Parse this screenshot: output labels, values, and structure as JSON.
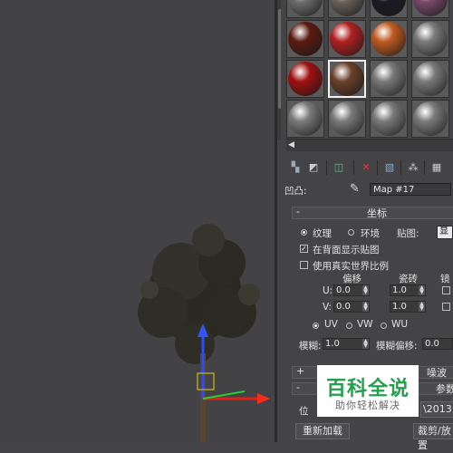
{
  "colors": {
    "viewport_bg": "#434345",
    "panel_bg": "#444446",
    "watermark_green": "#21a14b"
  },
  "slots": [
    {
      "name": "slot-1-1",
      "color": "#6e6e6e"
    },
    {
      "name": "slot-1-2",
      "color": "#6a625c"
    },
    {
      "name": "slot-1-3",
      "color": "#1a1a22"
    },
    {
      "name": "slot-1-4",
      "color": "#7a4a6a"
    },
    {
      "name": "slot-2-1",
      "color": "#5a1a10"
    },
    {
      "name": "slot-2-2",
      "color": "#b02020"
    },
    {
      "name": "slot-2-3",
      "color": "#c05a20"
    },
    {
      "name": "slot-2-4",
      "color": "#7a7a7a"
    },
    {
      "name": "slot-3-1",
      "color": "#a01010"
    },
    {
      "name": "slot-3-2",
      "color": "#6a4028"
    },
    {
      "name": "slot-3-3",
      "color": "#7a7a7a"
    },
    {
      "name": "slot-3-4",
      "color": "#7a7a7a"
    },
    {
      "name": "slot-4-1",
      "color": "#7a7a7a"
    },
    {
      "name": "slot-4-2",
      "color": "#7a7a7a"
    },
    {
      "name": "slot-4-3",
      "color": "#7a7a7a"
    },
    {
      "name": "slot-4-4",
      "color": "#7a7a7a"
    }
  ],
  "toolbar": {
    "icons": [
      {
        "name": "get-material-icon",
        "glyph": "▚",
        "color": "#9ab"
      },
      {
        "name": "put-to-scene-icon",
        "glyph": "◩",
        "color": "#ccc"
      },
      {
        "name": "assign-to-selection-icon",
        "glyph": "◫",
        "color": "#4c8"
      },
      {
        "name": "reset-map-icon",
        "glyph": "✕",
        "color": "#e33"
      },
      {
        "name": "copy-material-icon",
        "glyph": "▧",
        "color": "#8ac"
      },
      {
        "name": "make-unique-icon",
        "glyph": "⁂",
        "color": "#ccc"
      },
      {
        "name": "put-to-library-icon",
        "glyph": "▦",
        "color": "#ccc"
      }
    ]
  },
  "name_row": {
    "label": "凹凸:",
    "value": "Map #17"
  },
  "coordinates": {
    "title": "坐标",
    "texture": "纹理",
    "environ": "环境",
    "mapping_label": "贴图:",
    "mapping_value": "显",
    "show_map_on_back": "在背面显示贴图",
    "real_world_scale": "使用真实世界比例",
    "offset_label": "偏移",
    "tiling_label": "瓷砖",
    "mirror_label": "镜",
    "u_label": "U:",
    "v_label": "V:",
    "u_offset": "0.0",
    "u_tiling": "1.0",
    "v_offset": "0.0",
    "v_tiling": "1.0",
    "uv": "UV",
    "vw": "VW",
    "wu": "WU",
    "blur_label": "模糊:",
    "blur_value": "1.0",
    "blur_offset_label": "模糊偏移:",
    "blur_offset_value": "0.0"
  },
  "noise_rollout": {
    "pm": "+",
    "title": "噪波"
  },
  "bitmap_rollout": {
    "pm": "-",
    "partial_title": "参数",
    "bitmap_label": "位",
    "bitmap_path_partial": "\\2013",
    "reload": "重新加载",
    "crop_place": "裁剪/放置"
  },
  "watermark": {
    "title": "百科全说",
    "subtitle": "助你轻松解决"
  }
}
